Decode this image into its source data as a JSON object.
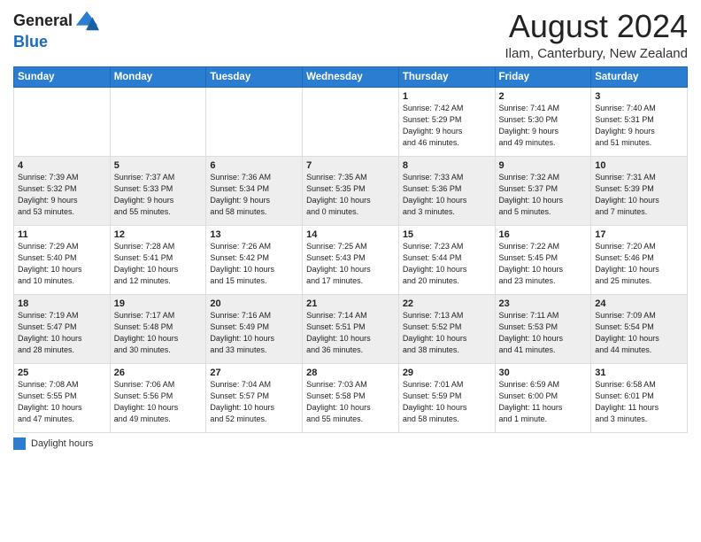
{
  "header": {
    "logo_general": "General",
    "logo_blue": "Blue",
    "title": "August 2024",
    "subtitle": "Ilam, Canterbury, New Zealand"
  },
  "days_of_week": [
    "Sunday",
    "Monday",
    "Tuesday",
    "Wednesday",
    "Thursday",
    "Friday",
    "Saturday"
  ],
  "legend_label": "Daylight hours",
  "weeks": [
    [
      {
        "num": "",
        "info": ""
      },
      {
        "num": "",
        "info": ""
      },
      {
        "num": "",
        "info": ""
      },
      {
        "num": "",
        "info": ""
      },
      {
        "num": "1",
        "info": "Sunrise: 7:42 AM\nSunset: 5:29 PM\nDaylight: 9 hours\nand 46 minutes."
      },
      {
        "num": "2",
        "info": "Sunrise: 7:41 AM\nSunset: 5:30 PM\nDaylight: 9 hours\nand 49 minutes."
      },
      {
        "num": "3",
        "info": "Sunrise: 7:40 AM\nSunset: 5:31 PM\nDaylight: 9 hours\nand 51 minutes."
      }
    ],
    [
      {
        "num": "4",
        "info": "Sunrise: 7:39 AM\nSunset: 5:32 PM\nDaylight: 9 hours\nand 53 minutes."
      },
      {
        "num": "5",
        "info": "Sunrise: 7:37 AM\nSunset: 5:33 PM\nDaylight: 9 hours\nand 55 minutes."
      },
      {
        "num": "6",
        "info": "Sunrise: 7:36 AM\nSunset: 5:34 PM\nDaylight: 9 hours\nand 58 minutes."
      },
      {
        "num": "7",
        "info": "Sunrise: 7:35 AM\nSunset: 5:35 PM\nDaylight: 10 hours\nand 0 minutes."
      },
      {
        "num": "8",
        "info": "Sunrise: 7:33 AM\nSunset: 5:36 PM\nDaylight: 10 hours\nand 3 minutes."
      },
      {
        "num": "9",
        "info": "Sunrise: 7:32 AM\nSunset: 5:37 PM\nDaylight: 10 hours\nand 5 minutes."
      },
      {
        "num": "10",
        "info": "Sunrise: 7:31 AM\nSunset: 5:39 PM\nDaylight: 10 hours\nand 7 minutes."
      }
    ],
    [
      {
        "num": "11",
        "info": "Sunrise: 7:29 AM\nSunset: 5:40 PM\nDaylight: 10 hours\nand 10 minutes."
      },
      {
        "num": "12",
        "info": "Sunrise: 7:28 AM\nSunset: 5:41 PM\nDaylight: 10 hours\nand 12 minutes."
      },
      {
        "num": "13",
        "info": "Sunrise: 7:26 AM\nSunset: 5:42 PM\nDaylight: 10 hours\nand 15 minutes."
      },
      {
        "num": "14",
        "info": "Sunrise: 7:25 AM\nSunset: 5:43 PM\nDaylight: 10 hours\nand 17 minutes."
      },
      {
        "num": "15",
        "info": "Sunrise: 7:23 AM\nSunset: 5:44 PM\nDaylight: 10 hours\nand 20 minutes."
      },
      {
        "num": "16",
        "info": "Sunrise: 7:22 AM\nSunset: 5:45 PM\nDaylight: 10 hours\nand 23 minutes."
      },
      {
        "num": "17",
        "info": "Sunrise: 7:20 AM\nSunset: 5:46 PM\nDaylight: 10 hours\nand 25 minutes."
      }
    ],
    [
      {
        "num": "18",
        "info": "Sunrise: 7:19 AM\nSunset: 5:47 PM\nDaylight: 10 hours\nand 28 minutes."
      },
      {
        "num": "19",
        "info": "Sunrise: 7:17 AM\nSunset: 5:48 PM\nDaylight: 10 hours\nand 30 minutes."
      },
      {
        "num": "20",
        "info": "Sunrise: 7:16 AM\nSunset: 5:49 PM\nDaylight: 10 hours\nand 33 minutes."
      },
      {
        "num": "21",
        "info": "Sunrise: 7:14 AM\nSunset: 5:51 PM\nDaylight: 10 hours\nand 36 minutes."
      },
      {
        "num": "22",
        "info": "Sunrise: 7:13 AM\nSunset: 5:52 PM\nDaylight: 10 hours\nand 38 minutes."
      },
      {
        "num": "23",
        "info": "Sunrise: 7:11 AM\nSunset: 5:53 PM\nDaylight: 10 hours\nand 41 minutes."
      },
      {
        "num": "24",
        "info": "Sunrise: 7:09 AM\nSunset: 5:54 PM\nDaylight: 10 hours\nand 44 minutes."
      }
    ],
    [
      {
        "num": "25",
        "info": "Sunrise: 7:08 AM\nSunset: 5:55 PM\nDaylight: 10 hours\nand 47 minutes."
      },
      {
        "num": "26",
        "info": "Sunrise: 7:06 AM\nSunset: 5:56 PM\nDaylight: 10 hours\nand 49 minutes."
      },
      {
        "num": "27",
        "info": "Sunrise: 7:04 AM\nSunset: 5:57 PM\nDaylight: 10 hours\nand 52 minutes."
      },
      {
        "num": "28",
        "info": "Sunrise: 7:03 AM\nSunset: 5:58 PM\nDaylight: 10 hours\nand 55 minutes."
      },
      {
        "num": "29",
        "info": "Sunrise: 7:01 AM\nSunset: 5:59 PM\nDaylight: 10 hours\nand 58 minutes."
      },
      {
        "num": "30",
        "info": "Sunrise: 6:59 AM\nSunset: 6:00 PM\nDaylight: 11 hours\nand 1 minute."
      },
      {
        "num": "31",
        "info": "Sunrise: 6:58 AM\nSunset: 6:01 PM\nDaylight: 11 hours\nand 3 minutes."
      }
    ]
  ]
}
